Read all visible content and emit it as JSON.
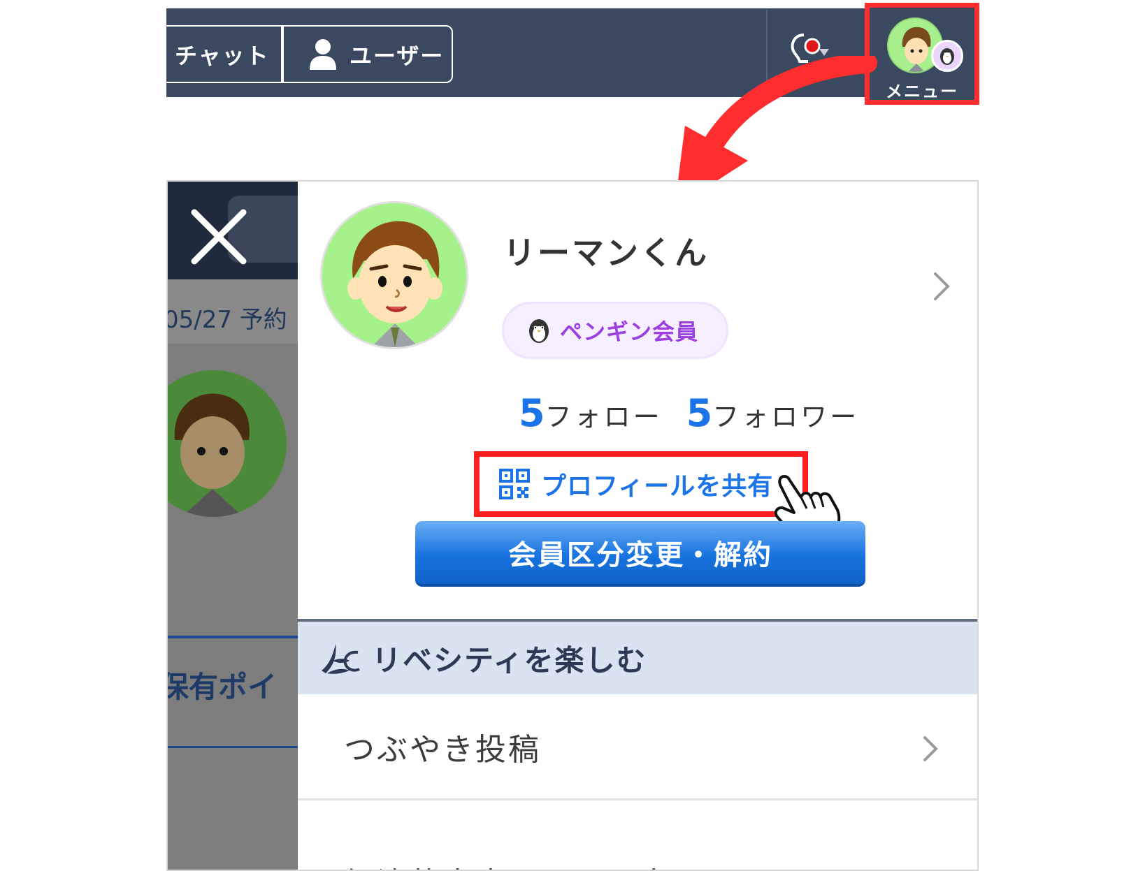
{
  "header": {
    "tab_chat": "チャット",
    "tab_user": "ユーザー",
    "menu_label": "メニュー"
  },
  "background": {
    "date_text": "05/27 予約",
    "points_text": "保有ポイ"
  },
  "profile": {
    "name": "リーマンくん",
    "badge": "ペンギン会員",
    "follow_count": "5",
    "follow_label": "フォロー",
    "follower_count": "5",
    "follower_label": "フォロワー",
    "share_label": "プロフィールを共有",
    "change_button": "会員区分変更・解約"
  },
  "section": {
    "title": "リベシティを楽しむ"
  },
  "menu_items": [
    {
      "label": "つぶやき投稿"
    },
    {
      "label": "経済的自由をつくる宿題リスト"
    }
  ],
  "colors": {
    "header_bg": "#3a4860",
    "highlight_red": "#ff1f1f",
    "accent_blue": "#1a73e8",
    "badge_purple": "#9b3fe0",
    "section_bg": "#dae3f2"
  }
}
